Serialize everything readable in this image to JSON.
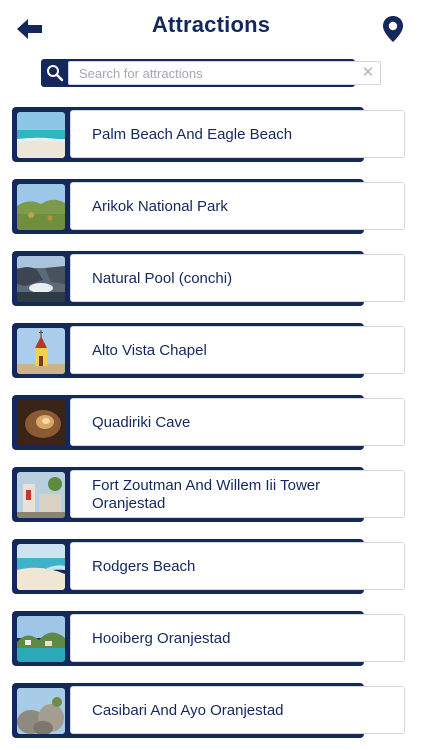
{
  "header": {
    "title": "Attractions",
    "back_icon": "arrow-left-icon",
    "location_icon": "map-pin-icon"
  },
  "search": {
    "placeholder": "Search for attractions",
    "value": "",
    "search_icon": "magnifier-icon",
    "clear_icon": "close-icon"
  },
  "colors": {
    "primary": "#14285e",
    "card_border": "#d3d8e2",
    "placeholder": "#a4a8b4"
  },
  "attractions": [
    {
      "name": "Palm Beach And Eagle Beach"
    },
    {
      "name": "Arikok National Park"
    },
    {
      "name": "Natural Pool (conchi)"
    },
    {
      "name": "Alto Vista Chapel"
    },
    {
      "name": "Quadiriki Cave"
    },
    {
      "name": "Fort Zoutman And Willem Iii Tower Oranjestad"
    },
    {
      "name": "Rodgers Beach"
    },
    {
      "name": "Hooiberg Oranjestad"
    },
    {
      "name": "Casibari And Ayo Oranjestad"
    }
  ]
}
